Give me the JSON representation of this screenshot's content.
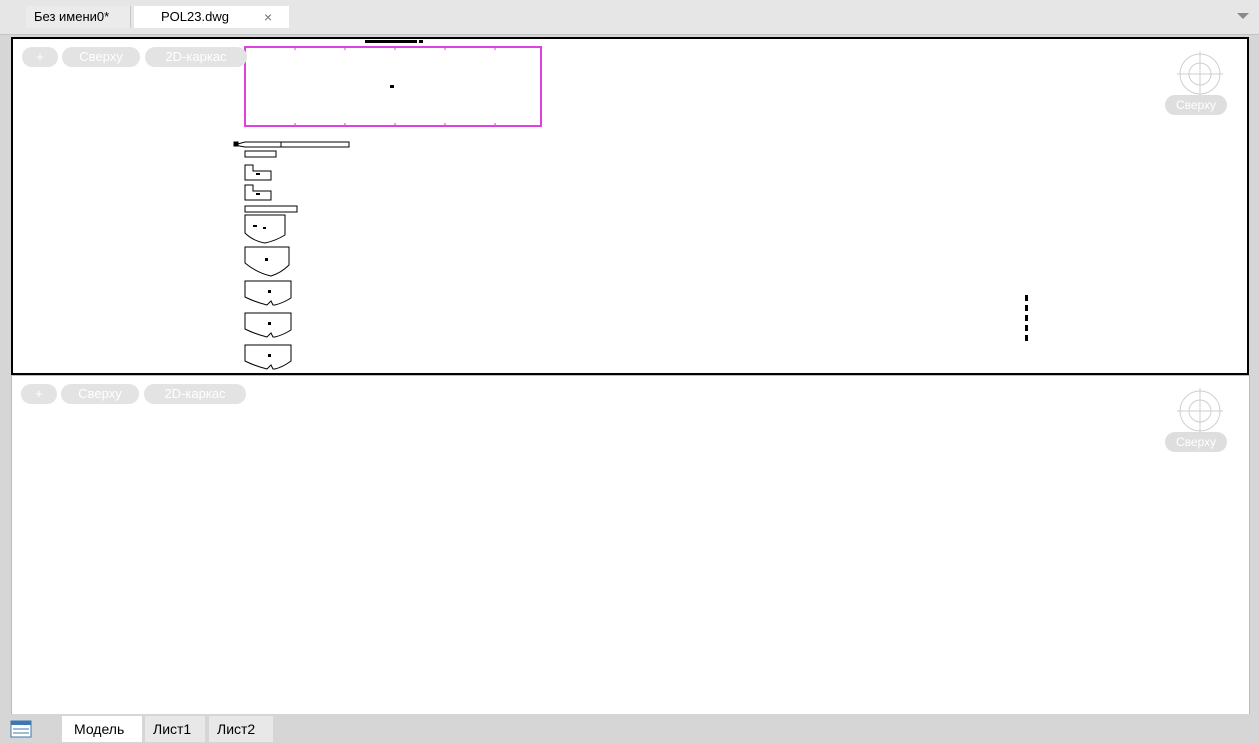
{
  "doc_tabs": [
    {
      "label": "Без имени0*"
    },
    {
      "label": "POL23.dwg",
      "close": "×"
    }
  ],
  "viewports": [
    {
      "controls": {
        "plus": "+",
        "view": "Сверху",
        "style": "2D-каркас"
      },
      "viewcube_label": "Сверху"
    },
    {
      "controls": {
        "plus": "+",
        "view": "Сверху",
        "style": "2D-каркас"
      },
      "viewcube_label": "Сверху"
    }
  ],
  "layout_tabs": [
    {
      "label": "Модель"
    },
    {
      "label": "Лист1"
    },
    {
      "label": "Лист2"
    }
  ],
  "colors": {
    "frame_magenta": "#e040e0",
    "ui_background": "#d6d6d6",
    "active_tab": "#ffffff"
  },
  "icons": [
    "close-icon",
    "dropdown-arrow-icon",
    "viewcube-compass-icon",
    "layout-list-icon"
  ]
}
